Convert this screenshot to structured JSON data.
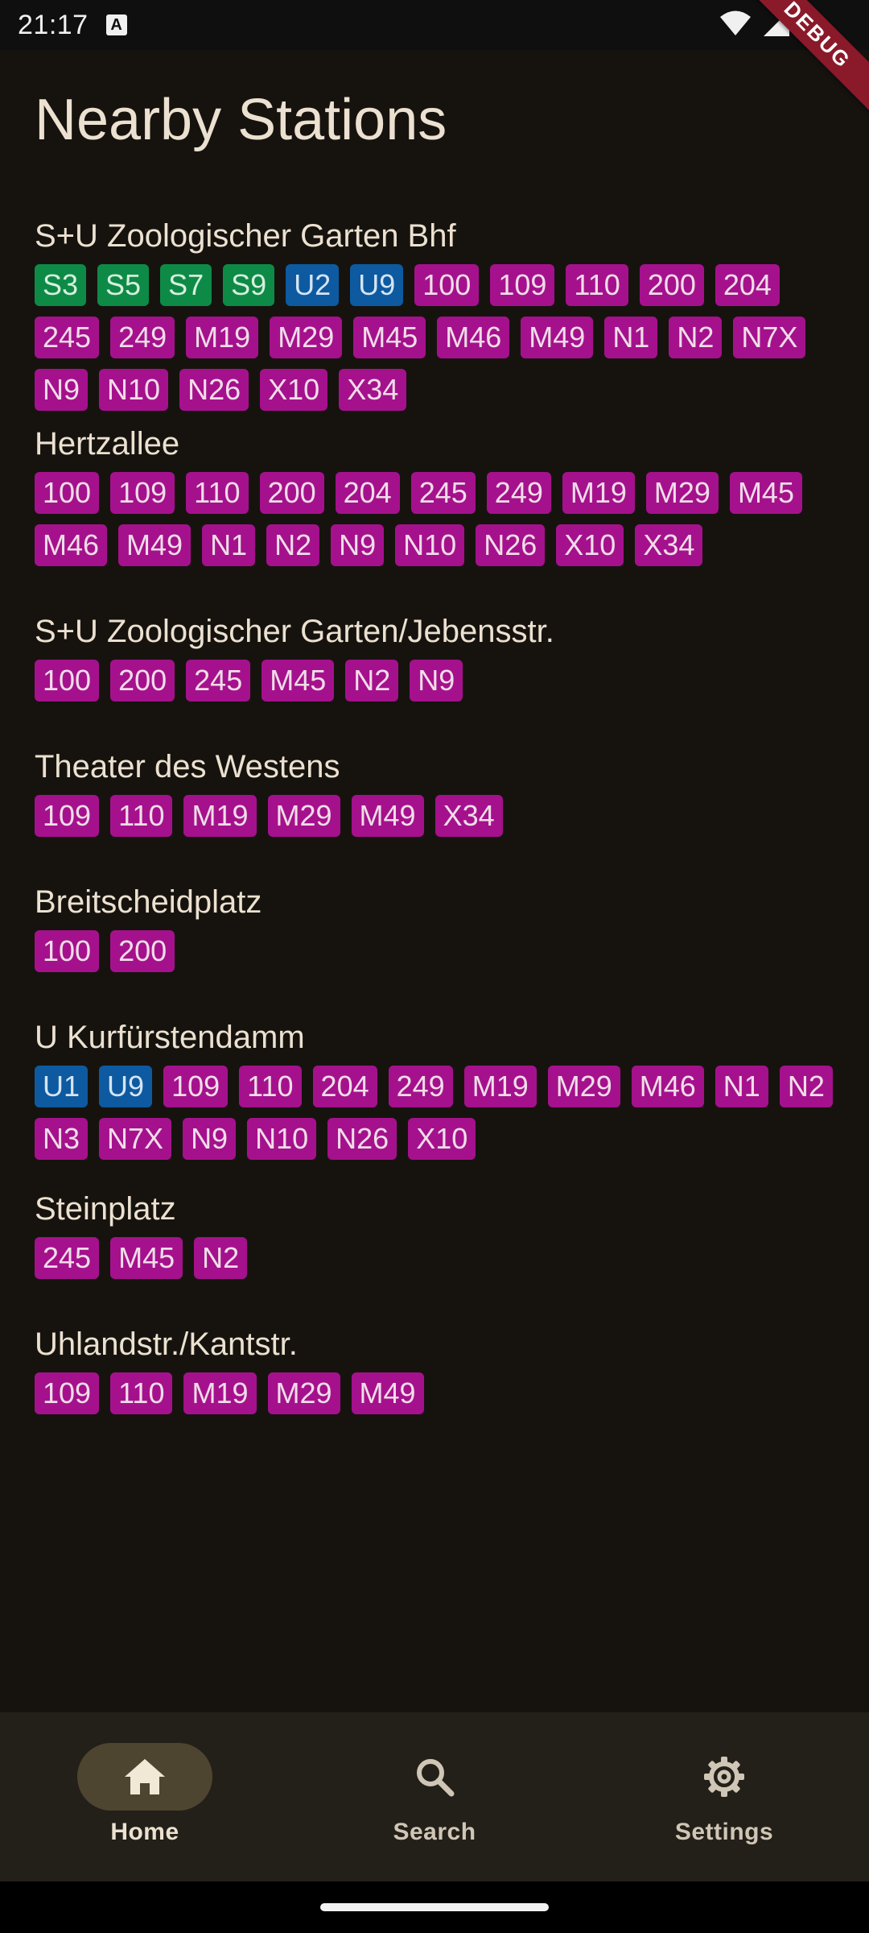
{
  "status_bar": {
    "time": "21:17",
    "notification_glyph": "A",
    "debug_label": "DEBUG"
  },
  "title": "Nearby Stations",
  "stations": [
    {
      "name": "S+U Zoologischer Garten Bhf",
      "lines": [
        {
          "label": "S3",
          "kind": "sbahn"
        },
        {
          "label": "S5",
          "kind": "sbahn"
        },
        {
          "label": "S7",
          "kind": "sbahn"
        },
        {
          "label": "S9",
          "kind": "sbahn"
        },
        {
          "label": "U2",
          "kind": "ubahn"
        },
        {
          "label": "U9",
          "kind": "ubahn"
        },
        {
          "label": "100",
          "kind": "bus"
        },
        {
          "label": "109",
          "kind": "bus"
        },
        {
          "label": "110",
          "kind": "bus"
        },
        {
          "label": "200",
          "kind": "bus"
        },
        {
          "label": "204",
          "kind": "bus"
        },
        {
          "label": "245",
          "kind": "bus"
        },
        {
          "label": "249",
          "kind": "bus"
        },
        {
          "label": "M19",
          "kind": "bus"
        },
        {
          "label": "M29",
          "kind": "bus"
        },
        {
          "label": "M45",
          "kind": "bus"
        },
        {
          "label": "M46",
          "kind": "bus"
        },
        {
          "label": "M49",
          "kind": "bus"
        },
        {
          "label": "N1",
          "kind": "bus"
        },
        {
          "label": "N2",
          "kind": "bus"
        },
        {
          "label": "N7X",
          "kind": "bus"
        },
        {
          "label": "N9",
          "kind": "bus"
        },
        {
          "label": "N10",
          "kind": "bus"
        },
        {
          "label": "N26",
          "kind": "bus"
        },
        {
          "label": "X10",
          "kind": "bus"
        },
        {
          "label": "X34",
          "kind": "bus"
        }
      ]
    },
    {
      "name": "Hertzallee",
      "lines": [
        {
          "label": "100",
          "kind": "bus"
        },
        {
          "label": "109",
          "kind": "bus"
        },
        {
          "label": "110",
          "kind": "bus"
        },
        {
          "label": "200",
          "kind": "bus"
        },
        {
          "label": "204",
          "kind": "bus"
        },
        {
          "label": "245",
          "kind": "bus"
        },
        {
          "label": "249",
          "kind": "bus"
        },
        {
          "label": "M19",
          "kind": "bus"
        },
        {
          "label": "M29",
          "kind": "bus"
        },
        {
          "label": "M45",
          "kind": "bus"
        },
        {
          "label": "M46",
          "kind": "bus"
        },
        {
          "label": "M49",
          "kind": "bus"
        },
        {
          "label": "N1",
          "kind": "bus"
        },
        {
          "label": "N2",
          "kind": "bus"
        },
        {
          "label": "N9",
          "kind": "bus"
        },
        {
          "label": "N10",
          "kind": "bus"
        },
        {
          "label": "N26",
          "kind": "bus"
        },
        {
          "label": "X10",
          "kind": "bus"
        },
        {
          "label": "X34",
          "kind": "bus"
        }
      ]
    },
    {
      "name": "S+U Zoologischer Garten/Jebensstr.",
      "lines": [
        {
          "label": "100",
          "kind": "bus"
        },
        {
          "label": "200",
          "kind": "bus"
        },
        {
          "label": "245",
          "kind": "bus"
        },
        {
          "label": "M45",
          "kind": "bus"
        },
        {
          "label": "N2",
          "kind": "bus"
        },
        {
          "label": "N9",
          "kind": "bus"
        }
      ]
    },
    {
      "name": "Theater des Westens",
      "lines": [
        {
          "label": "109",
          "kind": "bus"
        },
        {
          "label": "110",
          "kind": "bus"
        },
        {
          "label": "M19",
          "kind": "bus"
        },
        {
          "label": "M29",
          "kind": "bus"
        },
        {
          "label": "M49",
          "kind": "bus"
        },
        {
          "label": "X34",
          "kind": "bus"
        }
      ]
    },
    {
      "name": "Breitscheidplatz",
      "lines": [
        {
          "label": "100",
          "kind": "bus"
        },
        {
          "label": "200",
          "kind": "bus"
        }
      ]
    },
    {
      "name": "U Kurfürstendamm",
      "lines": [
        {
          "label": "U1",
          "kind": "ubahn"
        },
        {
          "label": "U9",
          "kind": "ubahn"
        },
        {
          "label": "109",
          "kind": "bus"
        },
        {
          "label": "110",
          "kind": "bus"
        },
        {
          "label": "204",
          "kind": "bus"
        },
        {
          "label": "249",
          "kind": "bus"
        },
        {
          "label": "M19",
          "kind": "bus"
        },
        {
          "label": "M29",
          "kind": "bus"
        },
        {
          "label": "M46",
          "kind": "bus"
        },
        {
          "label": "N1",
          "kind": "bus"
        },
        {
          "label": "N2",
          "kind": "bus"
        },
        {
          "label": "N3",
          "kind": "bus"
        },
        {
          "label": "N7X",
          "kind": "bus"
        },
        {
          "label": "N9",
          "kind": "bus"
        },
        {
          "label": "N10",
          "kind": "bus"
        },
        {
          "label": "N26",
          "kind": "bus"
        },
        {
          "label": "X10",
          "kind": "bus"
        }
      ]
    },
    {
      "name": "Steinplatz",
      "lines": [
        {
          "label": "245",
          "kind": "bus"
        },
        {
          "label": "M45",
          "kind": "bus"
        },
        {
          "label": "N2",
          "kind": "bus"
        }
      ]
    },
    {
      "name": "Uhlandstr./Kantstr.",
      "lines": [
        {
          "label": "109",
          "kind": "bus"
        },
        {
          "label": "110",
          "kind": "bus"
        },
        {
          "label": "M19",
          "kind": "bus"
        },
        {
          "label": "M29",
          "kind": "bus"
        },
        {
          "label": "M49",
          "kind": "bus"
        }
      ]
    }
  ],
  "nav": {
    "items": [
      {
        "label": "Home",
        "icon": "home-icon",
        "active": true
      },
      {
        "label": "Search",
        "icon": "search-icon",
        "active": false
      },
      {
        "label": "Settings",
        "icon": "gear-icon",
        "active": false
      }
    ]
  },
  "colors": {
    "background": "#16130f",
    "sbahn": "#0e8a47",
    "ubahn": "#0d5aa0",
    "bus": "#a5118c",
    "nav_background": "#231f19",
    "nav_active_pill": "#4e4530"
  }
}
